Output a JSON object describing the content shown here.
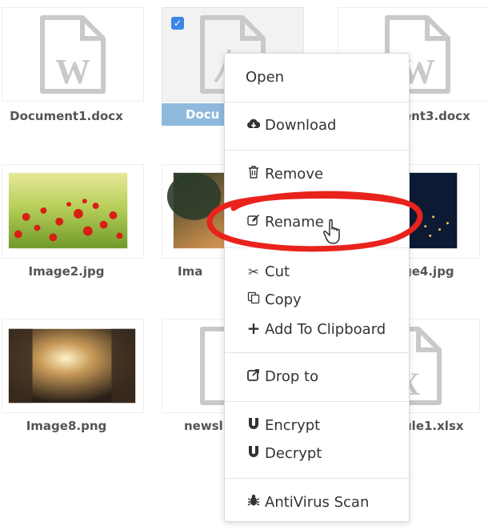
{
  "files": [
    {
      "name": "Document1.docx",
      "kind": "word"
    },
    {
      "name": "Docu",
      "kind": "pdf",
      "selected": true
    },
    {
      "name": "ent3.docx",
      "kind": "word"
    },
    {
      "name": "Image2.jpg",
      "kind": "image-flowers"
    },
    {
      "name": "Ima",
      "kind": "image-tree"
    },
    {
      "name": "ge4.jpg",
      "kind": "image-city"
    },
    {
      "name": "Image8.png",
      "kind": "image-alley"
    },
    {
      "name": "newsl",
      "kind": "generic"
    },
    {
      "name": "ule1.xlsx",
      "kind": "excel"
    }
  ],
  "context_menu": {
    "items": [
      {
        "label": "Open",
        "icon": ""
      },
      {
        "label": "Download",
        "icon": "cloud-download-icon"
      },
      {
        "label": "Remove",
        "icon": "trash-icon"
      },
      {
        "label": "Rename",
        "icon": "edit-icon",
        "highlighted": true
      },
      {
        "label": "Cut",
        "icon": "scissors-icon"
      },
      {
        "label": "Copy",
        "icon": "copy-icon"
      },
      {
        "label": "Add To Clipboard",
        "icon": "plus-icon"
      },
      {
        "label": "Drop to",
        "icon": "share-icon"
      },
      {
        "label": "Encrypt",
        "icon": "magnet-icon"
      },
      {
        "label": "Decrypt",
        "icon": "magnet-icon"
      },
      {
        "label": "AntiVirus Scan",
        "icon": "bug-icon"
      }
    ]
  },
  "colors": {
    "selection": "#8fb9dd",
    "checkbox": "#3b86e6",
    "annotation": "#e8231c",
    "doc_icon": "#c9c9c9"
  }
}
